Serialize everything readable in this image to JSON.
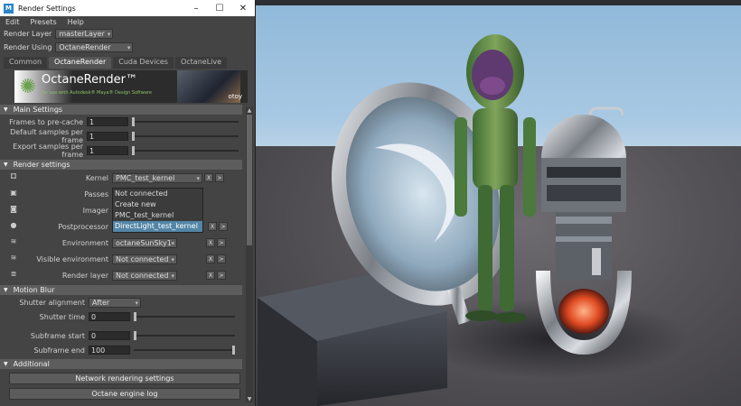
{
  "window": {
    "title": "Render Settings",
    "icon": "maya-icon"
  },
  "menu": [
    "Edit",
    "Presets",
    "Help"
  ],
  "render_layer": {
    "label": "Render Layer",
    "value": "masterLayer"
  },
  "render_using": {
    "label": "Render Using",
    "value": "OctaneRender"
  },
  "tabs": [
    "Common",
    "OctaneRender",
    "Cuda Devices",
    "OctaneLive"
  ],
  "active_tab": "OctaneRender",
  "banner": {
    "title": "OctaneRender™",
    "subtitle": "for use with Autodesk® Maya® Design Software",
    "brand": "otoy"
  },
  "main_settings": {
    "header": "Main Settings",
    "fields": [
      {
        "label": "Frames to pre-cache",
        "value": "1",
        "slider_fraction": 0.0
      },
      {
        "label": "Default samples per frame",
        "value": "1",
        "slider_fraction": 0.0
      },
      {
        "label": "Export samples per frame",
        "value": "1",
        "slider_fraction": 0.0
      }
    ]
  },
  "render_settings": {
    "header": "Render settings",
    "kernel": {
      "label": "Kernel",
      "value": "PMC_test_kernel"
    },
    "passes": {
      "label": "Passes"
    },
    "imager": {
      "label": "Imager"
    },
    "postprocessor": {
      "label": "Postprocessor"
    },
    "environment": {
      "label": "Environment",
      "value": "octaneSunSky1"
    },
    "visible_environment": {
      "label": "Visible environment",
      "value": "Not connected"
    },
    "render_layer": {
      "label": "Render layer",
      "value": "Not connected"
    },
    "btn_x": "X",
    "btn_go": ">"
  },
  "kernel_dropdown": [
    "Not connected",
    "Create new",
    "PMC_test_kernel",
    "DirectLight_test_kernel"
  ],
  "kernel_dropdown_highlighted": 3,
  "motion_blur": {
    "header": "Motion Blur",
    "shutter_alignment": {
      "label": "Shutter alignment",
      "value": "After"
    },
    "shutter_time": {
      "label": "Shutter time",
      "value": "0",
      "slider_fraction": 0.0
    },
    "subframe_start": {
      "label": "Subframe start",
      "value": "0",
      "slider_fraction": 0.0
    },
    "subframe_end": {
      "label": "Subframe end",
      "value": "100",
      "slider_fraction": 1.0
    }
  },
  "additional": {
    "header": "Additional",
    "buttons": [
      "Network rendering settings",
      "Octane engine log"
    ]
  },
  "colors": {
    "panel": "#444444",
    "section": "#5d5d5d",
    "highlight": "#5285a6",
    "accent_green": "#6aa24f"
  }
}
